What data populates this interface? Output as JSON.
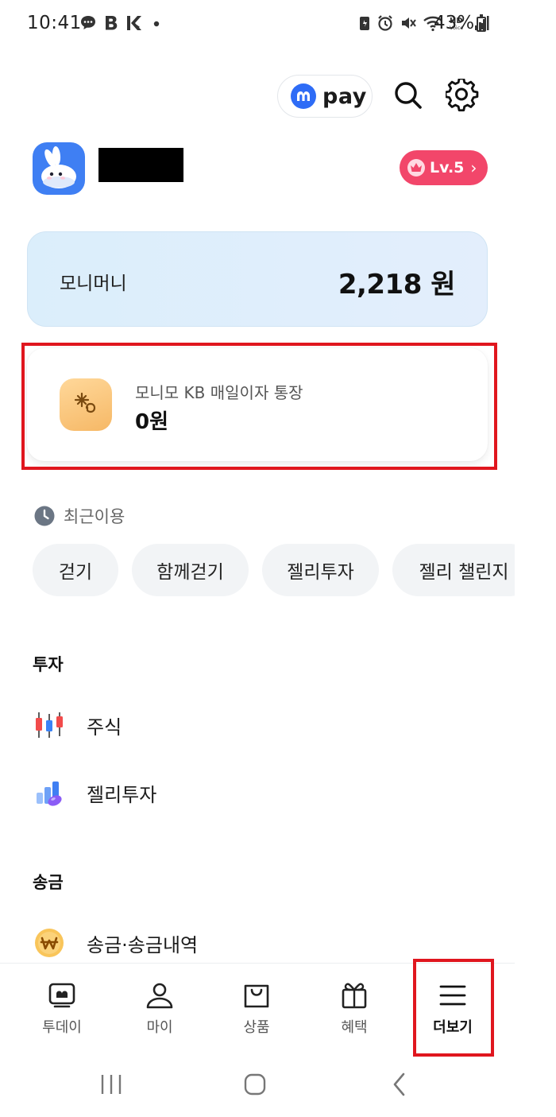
{
  "status_bar": {
    "time": "10:41",
    "battery": "43%"
  },
  "header": {
    "pay_label": "pay",
    "icons": [
      "pay-logo-icon",
      "search-icon",
      "gear-icon"
    ]
  },
  "profile": {
    "level": "Lv.5"
  },
  "moni_money": {
    "label": "모니머니",
    "value": "2,218 원"
  },
  "account": {
    "name": "모니모 KB 매일이자 통장",
    "balance": "0원"
  },
  "recent": {
    "title": "최근이용",
    "chips": [
      "걷기",
      "함께걷기",
      "젤리투자",
      "젤리 챌린지"
    ]
  },
  "sections": [
    {
      "title": "투자",
      "items": [
        {
          "label": "주식",
          "icon": "stock-chart-icon"
        },
        {
          "label": "젤리투자",
          "icon": "jelly-invest-icon"
        }
      ]
    },
    {
      "title": "송금",
      "items": [
        {
          "label": "송금·송금내역",
          "icon": "won-coin-icon"
        }
      ]
    }
  ],
  "bottom_nav": {
    "items": [
      {
        "label": "투데이",
        "icon": "today-icon"
      },
      {
        "label": "마이",
        "icon": "person-icon"
      },
      {
        "label": "상품",
        "icon": "shopping-bag-icon"
      },
      {
        "label": "혜택",
        "icon": "gift-icon"
      },
      {
        "label": "더보기",
        "icon": "menu-icon"
      }
    ],
    "active_index": 4
  },
  "colors": {
    "accent_blue": "#2e6cf6",
    "level_pink": "#f2466a",
    "highlight_red": "#e0161e",
    "money_card_bg": "#dfeefb"
  }
}
